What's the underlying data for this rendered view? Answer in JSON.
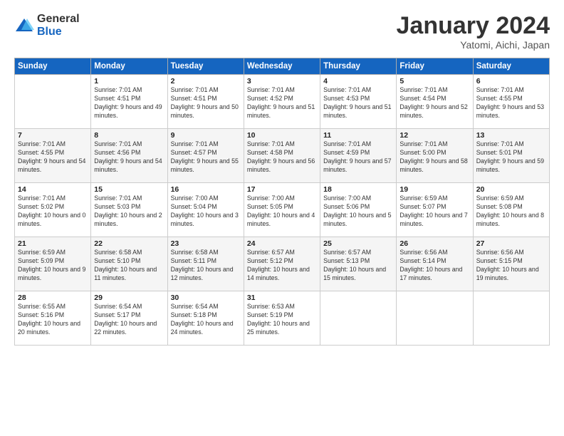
{
  "logo": {
    "general": "General",
    "blue": "Blue"
  },
  "title": "January 2024",
  "subtitle": "Yatomi, Aichi, Japan",
  "days_of_week": [
    "Sunday",
    "Monday",
    "Tuesday",
    "Wednesday",
    "Thursday",
    "Friday",
    "Saturday"
  ],
  "weeks": [
    [
      {
        "day": "",
        "sunrise": "",
        "sunset": "",
        "daylight": ""
      },
      {
        "day": "1",
        "sunrise": "Sunrise: 7:01 AM",
        "sunset": "Sunset: 4:51 PM",
        "daylight": "Daylight: 9 hours and 49 minutes."
      },
      {
        "day": "2",
        "sunrise": "Sunrise: 7:01 AM",
        "sunset": "Sunset: 4:51 PM",
        "daylight": "Daylight: 9 hours and 50 minutes."
      },
      {
        "day": "3",
        "sunrise": "Sunrise: 7:01 AM",
        "sunset": "Sunset: 4:52 PM",
        "daylight": "Daylight: 9 hours and 51 minutes."
      },
      {
        "day": "4",
        "sunrise": "Sunrise: 7:01 AM",
        "sunset": "Sunset: 4:53 PM",
        "daylight": "Daylight: 9 hours and 51 minutes."
      },
      {
        "day": "5",
        "sunrise": "Sunrise: 7:01 AM",
        "sunset": "Sunset: 4:54 PM",
        "daylight": "Daylight: 9 hours and 52 minutes."
      },
      {
        "day": "6",
        "sunrise": "Sunrise: 7:01 AM",
        "sunset": "Sunset: 4:55 PM",
        "daylight": "Daylight: 9 hours and 53 minutes."
      }
    ],
    [
      {
        "day": "7",
        "sunrise": "Sunrise: 7:01 AM",
        "sunset": "Sunset: 4:55 PM",
        "daylight": "Daylight: 9 hours and 54 minutes."
      },
      {
        "day": "8",
        "sunrise": "Sunrise: 7:01 AM",
        "sunset": "Sunset: 4:56 PM",
        "daylight": "Daylight: 9 hours and 54 minutes."
      },
      {
        "day": "9",
        "sunrise": "Sunrise: 7:01 AM",
        "sunset": "Sunset: 4:57 PM",
        "daylight": "Daylight: 9 hours and 55 minutes."
      },
      {
        "day": "10",
        "sunrise": "Sunrise: 7:01 AM",
        "sunset": "Sunset: 4:58 PM",
        "daylight": "Daylight: 9 hours and 56 minutes."
      },
      {
        "day": "11",
        "sunrise": "Sunrise: 7:01 AM",
        "sunset": "Sunset: 4:59 PM",
        "daylight": "Daylight: 9 hours and 57 minutes."
      },
      {
        "day": "12",
        "sunrise": "Sunrise: 7:01 AM",
        "sunset": "Sunset: 5:00 PM",
        "daylight": "Daylight: 9 hours and 58 minutes."
      },
      {
        "day": "13",
        "sunrise": "Sunrise: 7:01 AM",
        "sunset": "Sunset: 5:01 PM",
        "daylight": "Daylight: 9 hours and 59 minutes."
      }
    ],
    [
      {
        "day": "14",
        "sunrise": "Sunrise: 7:01 AM",
        "sunset": "Sunset: 5:02 PM",
        "daylight": "Daylight: 10 hours and 0 minutes."
      },
      {
        "day": "15",
        "sunrise": "Sunrise: 7:01 AM",
        "sunset": "Sunset: 5:03 PM",
        "daylight": "Daylight: 10 hours and 2 minutes."
      },
      {
        "day": "16",
        "sunrise": "Sunrise: 7:00 AM",
        "sunset": "Sunset: 5:04 PM",
        "daylight": "Daylight: 10 hours and 3 minutes."
      },
      {
        "day": "17",
        "sunrise": "Sunrise: 7:00 AM",
        "sunset": "Sunset: 5:05 PM",
        "daylight": "Daylight: 10 hours and 4 minutes."
      },
      {
        "day": "18",
        "sunrise": "Sunrise: 7:00 AM",
        "sunset": "Sunset: 5:06 PM",
        "daylight": "Daylight: 10 hours and 5 minutes."
      },
      {
        "day": "19",
        "sunrise": "Sunrise: 6:59 AM",
        "sunset": "Sunset: 5:07 PM",
        "daylight": "Daylight: 10 hours and 7 minutes."
      },
      {
        "day": "20",
        "sunrise": "Sunrise: 6:59 AM",
        "sunset": "Sunset: 5:08 PM",
        "daylight": "Daylight: 10 hours and 8 minutes."
      }
    ],
    [
      {
        "day": "21",
        "sunrise": "Sunrise: 6:59 AM",
        "sunset": "Sunset: 5:09 PM",
        "daylight": "Daylight: 10 hours and 9 minutes."
      },
      {
        "day": "22",
        "sunrise": "Sunrise: 6:58 AM",
        "sunset": "Sunset: 5:10 PM",
        "daylight": "Daylight: 10 hours and 11 minutes."
      },
      {
        "day": "23",
        "sunrise": "Sunrise: 6:58 AM",
        "sunset": "Sunset: 5:11 PM",
        "daylight": "Daylight: 10 hours and 12 minutes."
      },
      {
        "day": "24",
        "sunrise": "Sunrise: 6:57 AM",
        "sunset": "Sunset: 5:12 PM",
        "daylight": "Daylight: 10 hours and 14 minutes."
      },
      {
        "day": "25",
        "sunrise": "Sunrise: 6:57 AM",
        "sunset": "Sunset: 5:13 PM",
        "daylight": "Daylight: 10 hours and 15 minutes."
      },
      {
        "day": "26",
        "sunrise": "Sunrise: 6:56 AM",
        "sunset": "Sunset: 5:14 PM",
        "daylight": "Daylight: 10 hours and 17 minutes."
      },
      {
        "day": "27",
        "sunrise": "Sunrise: 6:56 AM",
        "sunset": "Sunset: 5:15 PM",
        "daylight": "Daylight: 10 hours and 19 minutes."
      }
    ],
    [
      {
        "day": "28",
        "sunrise": "Sunrise: 6:55 AM",
        "sunset": "Sunset: 5:16 PM",
        "daylight": "Daylight: 10 hours and 20 minutes."
      },
      {
        "day": "29",
        "sunrise": "Sunrise: 6:54 AM",
        "sunset": "Sunset: 5:17 PM",
        "daylight": "Daylight: 10 hours and 22 minutes."
      },
      {
        "day": "30",
        "sunrise": "Sunrise: 6:54 AM",
        "sunset": "Sunset: 5:18 PM",
        "daylight": "Daylight: 10 hours and 24 minutes."
      },
      {
        "day": "31",
        "sunrise": "Sunrise: 6:53 AM",
        "sunset": "Sunset: 5:19 PM",
        "daylight": "Daylight: 10 hours and 25 minutes."
      },
      {
        "day": "",
        "sunrise": "",
        "sunset": "",
        "daylight": ""
      },
      {
        "day": "",
        "sunrise": "",
        "sunset": "",
        "daylight": ""
      },
      {
        "day": "",
        "sunrise": "",
        "sunset": "",
        "daylight": ""
      }
    ]
  ]
}
